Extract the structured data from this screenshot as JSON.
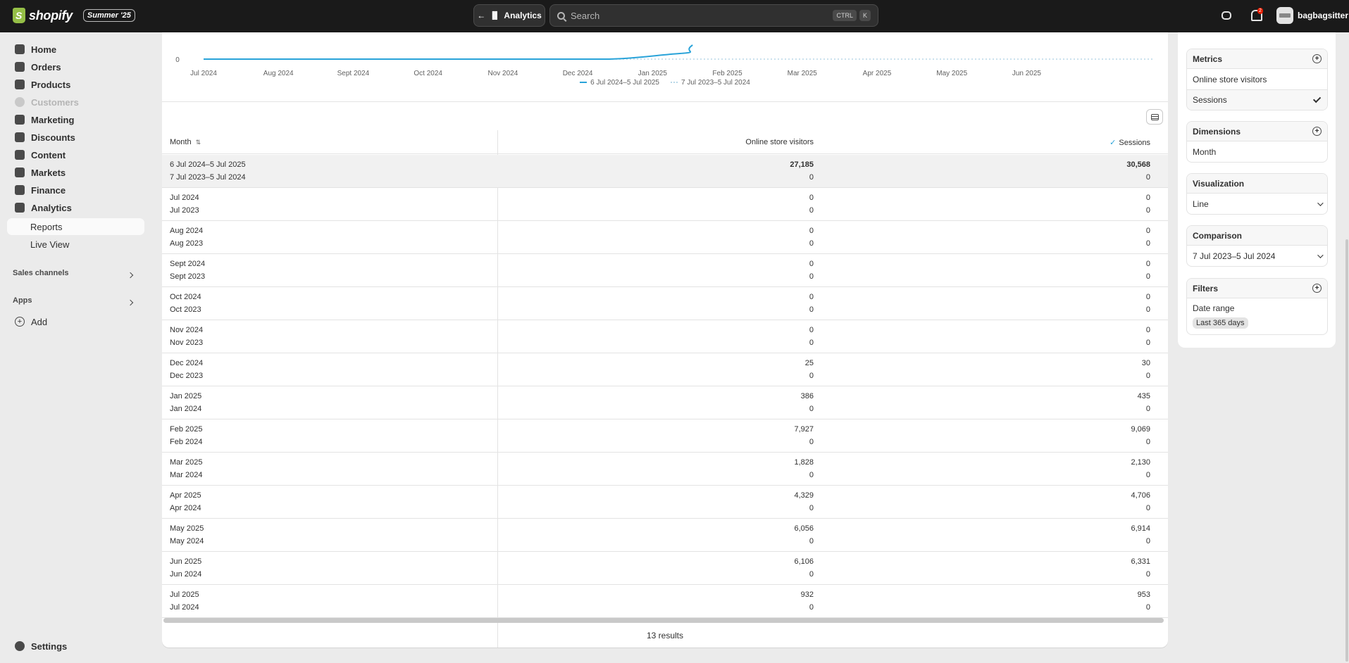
{
  "topbar": {
    "brand": "shopify",
    "edition": "Summer '25",
    "back_label": "Analytics",
    "search_placeholder": "Search",
    "shortcut_ctrl": "CTRL",
    "shortcut_key": "K",
    "notification_count": "2",
    "store_name": "bagbagsitter"
  },
  "sidebar": {
    "items": [
      {
        "label": "Home"
      },
      {
        "label": "Orders"
      },
      {
        "label": "Products"
      },
      {
        "label": "Customers"
      },
      {
        "label": "Marketing"
      },
      {
        "label": "Discounts"
      },
      {
        "label": "Content"
      },
      {
        "label": "Markets"
      },
      {
        "label": "Finance"
      },
      {
        "label": "Analytics"
      }
    ],
    "sub_items": [
      {
        "label": "Reports"
      },
      {
        "label": "Live View"
      }
    ],
    "sales_channels": "Sales channels",
    "apps": "Apps",
    "add": "Add",
    "settings": "Settings"
  },
  "chart_data": {
    "type": "line",
    "x_tick_labels": [
      "Jul 2024",
      "Aug 2024",
      "Sept 2024",
      "Oct 2024",
      "Nov 2024",
      "Dec 2024",
      "Jan 2025",
      "Feb 2025",
      "Mar 2025",
      "Apr 2025",
      "May 2025",
      "Jun 2025"
    ],
    "y_tick_visible": "0",
    "series": [
      {
        "name": "6 Jul 2024–5 Jul 2025",
        "style": "solid",
        "color": "#29a3d9"
      },
      {
        "name": "7 Jul 2023–5 Jul 2024",
        "style": "dotted",
        "color": "#b8d7e8"
      }
    ]
  },
  "table": {
    "headers": {
      "month": "Month",
      "visitors": "Online store visitors",
      "sessions": "Sessions"
    },
    "summary": {
      "period": "6 Jul 2024–5 Jul 2025",
      "compare_period": "7 Jul 2023–5 Jul 2024",
      "visitors": "27,185",
      "visitors_compare": "0",
      "sessions": "30,568",
      "sessions_compare": "0"
    },
    "rows": [
      {
        "month": "Jul 2024",
        "compare_month": "Jul 2023",
        "visitors": "0",
        "visitors_compare": "0",
        "sessions": "0",
        "sessions_compare": "0"
      },
      {
        "month": "Aug 2024",
        "compare_month": "Aug 2023",
        "visitors": "0",
        "visitors_compare": "0",
        "sessions": "0",
        "sessions_compare": "0"
      },
      {
        "month": "Sept 2024",
        "compare_month": "Sept 2023",
        "visitors": "0",
        "visitors_compare": "0",
        "sessions": "0",
        "sessions_compare": "0"
      },
      {
        "month": "Oct 2024",
        "compare_month": "Oct 2023",
        "visitors": "0",
        "visitors_compare": "0",
        "sessions": "0",
        "sessions_compare": "0"
      },
      {
        "month": "Nov 2024",
        "compare_month": "Nov 2023",
        "visitors": "0",
        "visitors_compare": "0",
        "sessions": "0",
        "sessions_compare": "0"
      },
      {
        "month": "Dec 2024",
        "compare_month": "Dec 2023",
        "visitors": "25",
        "visitors_compare": "0",
        "sessions": "30",
        "sessions_compare": "0"
      },
      {
        "month": "Jan 2025",
        "compare_month": "Jan 2024",
        "visitors": "386",
        "visitors_compare": "0",
        "sessions": "435",
        "sessions_compare": "0"
      },
      {
        "month": "Feb 2025",
        "compare_month": "Feb 2024",
        "visitors": "7,927",
        "visitors_compare": "0",
        "sessions": "9,069",
        "sessions_compare": "0"
      },
      {
        "month": "Mar 2025",
        "compare_month": "Mar 2024",
        "visitors": "1,828",
        "visitors_compare": "0",
        "sessions": "2,130",
        "sessions_compare": "0"
      },
      {
        "month": "Apr 2025",
        "compare_month": "Apr 2024",
        "visitors": "4,329",
        "visitors_compare": "0",
        "sessions": "4,706",
        "sessions_compare": "0"
      },
      {
        "month": "May 2025",
        "compare_month": "May 2024",
        "visitors": "6,056",
        "visitors_compare": "0",
        "sessions": "6,914",
        "sessions_compare": "0"
      },
      {
        "month": "Jun 2025",
        "compare_month": "Jun 2024",
        "visitors": "6,106",
        "visitors_compare": "0",
        "sessions": "6,331",
        "sessions_compare": "0"
      },
      {
        "month": "Jul 2025",
        "compare_month": "Jul 2024",
        "visitors": "932",
        "visitors_compare": "0",
        "sessions": "953",
        "sessions_compare": "0"
      }
    ],
    "results": "13 results"
  },
  "panel": {
    "metrics_title": "Metrics",
    "metrics": [
      "Online store visitors",
      "Sessions"
    ],
    "dimensions_title": "Dimensions",
    "dimension": "Month",
    "visualization_title": "Visualization",
    "visualization": "Line",
    "comparison_title": "Comparison",
    "comparison": "7 Jul 2023–5 Jul 2024",
    "filters_title": "Filters",
    "filter_label": "Date range",
    "filter_value": "Last 365 days"
  }
}
